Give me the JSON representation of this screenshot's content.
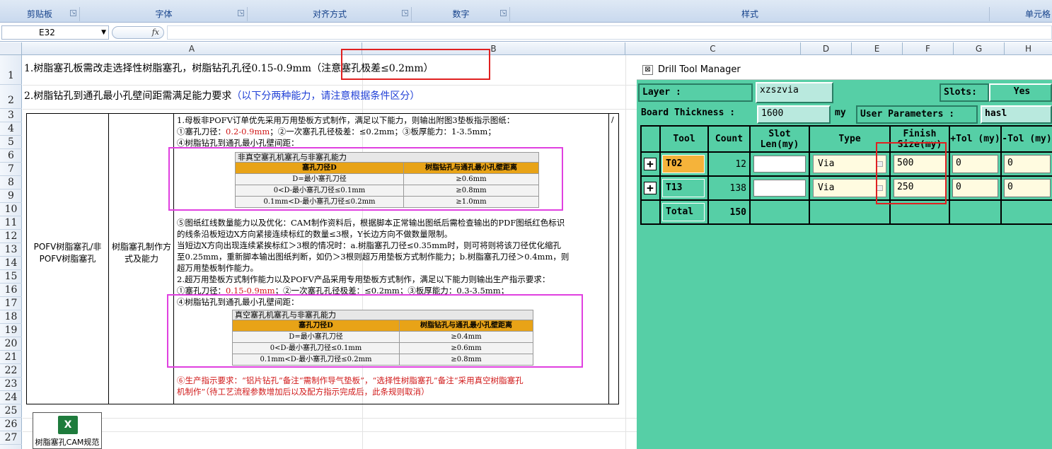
{
  "ribbon": {
    "groups": [
      "剪贴板",
      "字体",
      "对齐方式",
      "数字",
      "样式",
      "单元格"
    ]
  },
  "formula_bar": {
    "name_box": "E32",
    "fx_label": "fx",
    "formula": ""
  },
  "columns": [
    "A",
    "B",
    "C",
    "D",
    "E",
    "F",
    "G",
    "H"
  ],
  "rows": [
    "1",
    "2",
    "3",
    "4",
    "5",
    "6",
    "7",
    "8",
    "9",
    "10",
    "11",
    "12",
    "13",
    "14",
    "15",
    "16",
    "17",
    "18",
    "19",
    "20",
    "21",
    "22",
    "23",
    "24",
    "25",
    "26",
    "27"
  ],
  "sheet": {
    "line1": "1.树脂塞孔板需改走选择性树脂塞孔，树脂钻孔孔径0.15-0.9mm（注意塞孔极差≤0.2mm）",
    "line2_a": "2.树脂钻孔到通孔最小孔壁间距需满足能力要求",
    "line2_b": "（以下分两种能力，请注意根据条件区分）",
    "col_a": "POFV树脂塞孔/非POFV树脂塞孔",
    "col_b": "树脂塞孔制作方式及能力",
    "slash": "/",
    "p1": "1.母板非POFV订单优先采用万用垫板方式制作，满足以下能力，则输出附图3垫板指示图纸：",
    "p2a": "①塞孔刀径：",
    "p2b": "0.2-0.9mm",
    "p2c": "；②一次塞孔孔径极差：≤0.2mm；③板厚能力：1-3.5mm；",
    "p3": "④树脂钻孔到通孔最小孔壁间距：",
    "p4": "⑤图纸红线数量能力以及优化：CAM制作资料后，根据脚本正常输出图纸后需检查输出的PDF图纸红色标识",
    "p5": "的线条沿板短边X方向紧接连续标红的数量≤3根，Y长边方向不做数量限制。",
    "p6": "当短边X方向出现连续紧挨标红＞3根的情况时：a.树脂塞孔刀径≤0.35mm时，则可将则将该刀径优化缩孔",
    "p7": "至0.25mm，重新脚本输出图纸判断，如仍＞3根则超万用垫板方式制作能力；b.树脂塞孔刀径＞0.4mm，则",
    "p8": "超万用垫板制作能力。",
    "p9": "2.超万用垫板方式制作能力以及POFV产品采用专用垫板方式制作，满足以下能力则输出生产指示要求：",
    "p10a": "①塞孔刀径：",
    "p10b": "0.15-0.9mm",
    "p10c": "；②一次塞孔孔径极差：≤0.2mm；③板厚能力：0.3-3.5mm；",
    "p11": "④树脂钻孔到通孔最小孔壁间距：",
    "p12": "⑥生产指示要求：“铝片钻孔”备注“需制作导气垫板”，“选择性树脂塞孔”备注“采用真空树脂塞孔",
    "p13": "机制作”（待工艺流程参数增加后以及配方指示完成后，此条规则取消）",
    "table1": {
      "caption": "非真空塞孔机塞孔与非塞孔能力",
      "headers": [
        "塞孔刀径D",
        "树脂钻孔与通孔最小孔壁距离"
      ],
      "rows": [
        [
          "D=最小塞孔刀径",
          "≥0.6mm"
        ],
        [
          "0<D-最小塞孔刀径≤0.1mm",
          "≥0.8mm"
        ],
        [
          "0.1mm<D-最小塞孔刀径≤0.2mm",
          "≥1.0mm"
        ]
      ]
    },
    "table2": {
      "caption": "真空塞孔机塞孔与非塞孔能力",
      "headers": [
        "塞孔刀径D",
        "树脂钻孔与通孔最小孔壁距离"
      ],
      "rows": [
        [
          "D=最小塞孔刀径",
          "≥0.4mm"
        ],
        [
          "0<D-最小塞孔刀径≤0.1mm",
          "≥0.6mm"
        ],
        [
          "0.1mm<D-最小塞孔刀径≤0.2mm",
          "≥0.8mm"
        ]
      ]
    },
    "embedded_icon_label": "树脂塞孔CAM规范"
  },
  "drill_tool_manager": {
    "title": "Drill Tool Manager",
    "layer_label": "Layer           :",
    "layer_value": "xzszvia",
    "slots_label": "Slots:",
    "slots_value": "Yes",
    "board_thickness_label": "Board Thickness :",
    "board_thickness_value": "1600",
    "board_thickness_unit": "my",
    "user_params_label": "User Parameters :",
    "user_params_value": "hasl",
    "headers": [
      "Tool",
      "Count",
      "Slot Len(my)",
      "Type",
      "Finish Size(my)",
      "+Tol (my)",
      "-Tol (my)"
    ],
    "tools": [
      {
        "tool": "T02",
        "count": "12",
        "slot_len": "",
        "type": "Via",
        "finish": "500",
        "ptol": "0",
        "ntol": "0"
      },
      {
        "tool": "T13",
        "count": "138",
        "slot_len": "",
        "type": "Via",
        "finish": "250",
        "ptol": "0",
        "ntol": "0"
      }
    ],
    "total_label": "Total",
    "total_count": "150"
  },
  "colors": {
    "dtm_bg": "#56cfa6",
    "tool_button": "#f5b33a",
    "highlight_red": "#e02020",
    "highlight_magenta": "#e040e0",
    "table_header": "#e8a317"
  }
}
